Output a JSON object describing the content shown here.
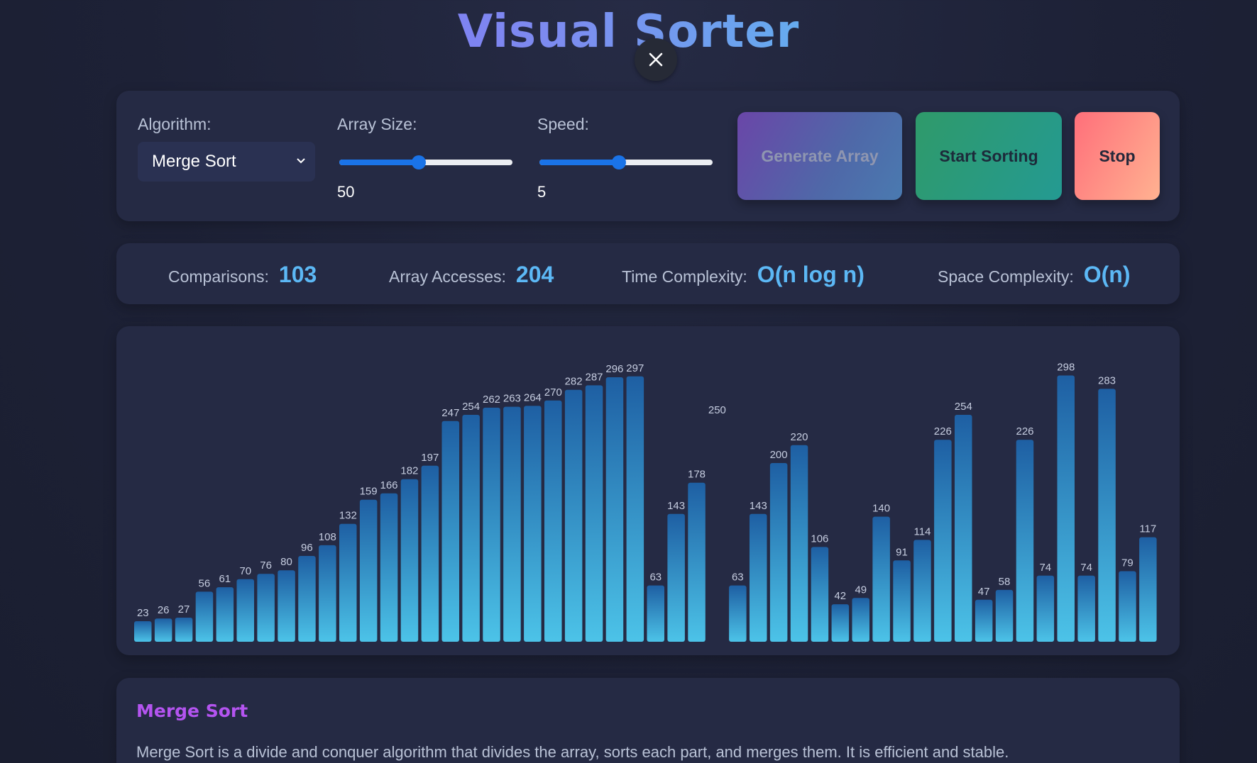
{
  "app": {
    "title": "Visual Sorter"
  },
  "close_icon": "close-icon",
  "controls": {
    "algorithm_label": "Algorithm:",
    "algorithm_value": "Merge Sort",
    "array_size_label": "Array Size:",
    "array_size_value": "50",
    "array_size_fraction": 0.46,
    "speed_label": "Speed:",
    "speed_value": "5",
    "speed_fraction": 0.46,
    "generate_label": "Generate Array",
    "start_label": "Start Sorting",
    "stop_label": "Stop"
  },
  "stats": {
    "comparisons_label": "Comparisons:",
    "comparisons_value": "103",
    "accesses_label": "Array Accesses:",
    "accesses_value": "204",
    "time_label": "Time Complexity:",
    "time_value": "O(n log n)",
    "space_label": "Space Complexity:",
    "space_value": "O(n)"
  },
  "info": {
    "title": "Merge Sort",
    "description": "Merge Sort is a divide and conquer algorithm that divides the array, sorts each part, and merges them. It is efficient and stable."
  },
  "colors": {
    "bar_top": "#1e5fa3",
    "bar_bottom": "#4cc3e8",
    "accent": "#5cb8f5",
    "title_purple": "#8b5cf6",
    "info_title": "#b454f0"
  },
  "chart_data": {
    "type": "bar",
    "values": [
      23,
      26,
      27,
      56,
      61,
      70,
      76,
      80,
      96,
      108,
      132,
      159,
      166,
      182,
      197,
      247,
      254,
      262,
      263,
      264,
      270,
      282,
      287,
      296,
      297,
      63,
      143,
      178,
      250,
      63,
      143,
      200,
      220,
      106,
      42,
      49,
      140,
      91,
      114,
      226,
      254,
      47,
      58,
      226,
      74,
      298,
      74,
      283,
      79,
      117
    ],
    "hidden_bar_index": 28,
    "ylim": [
      0,
      300
    ]
  }
}
